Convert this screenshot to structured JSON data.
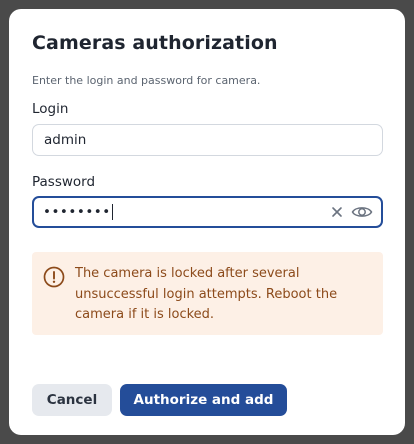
{
  "dialog": {
    "title": "Cameras authorization",
    "subtitle": "Enter the login and password for camera."
  },
  "login": {
    "label": "Login",
    "value": "admin"
  },
  "password": {
    "label": "Password",
    "masked_value": "••••••••",
    "clear_icon": "close-icon",
    "toggle_icon": "eye-icon"
  },
  "warning": {
    "icon": "exclamation-circle-icon",
    "text": "The camera is locked after several unsuccessful login attempts. Reboot the camera if it is locked."
  },
  "buttons": {
    "cancel_label": "Cancel",
    "authorize_label": "Authorize and add"
  },
  "colors": {
    "primary": "#244d99",
    "warning_bg": "#fdf0e6",
    "warning_text": "#8c4a1a",
    "overlay": "#4a4a4a"
  }
}
